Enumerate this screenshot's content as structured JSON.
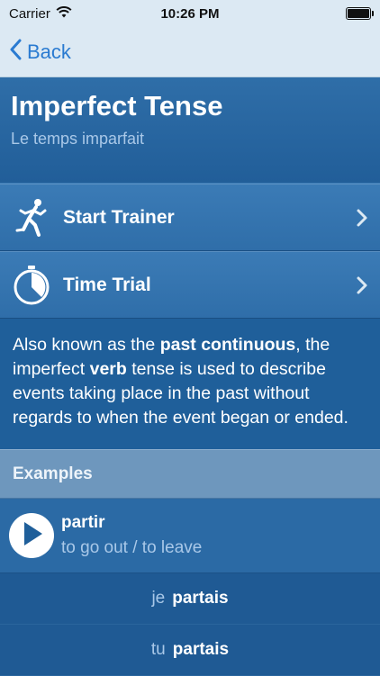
{
  "status": {
    "carrier": "Carrier",
    "time": "10:26 PM"
  },
  "nav": {
    "back_label": "Back"
  },
  "header": {
    "title": "Imperfect Tense",
    "subtitle": "Le temps imparfait"
  },
  "menu": [
    {
      "label": "Start Trainer",
      "icon": "runner-icon"
    },
    {
      "label": "Time Trial",
      "icon": "stopwatch-icon"
    }
  ],
  "description": {
    "p1": "Also known as the ",
    "b1": "past continuous",
    "p2": ", the imperfect ",
    "b2": "verb",
    "p3": " tense is used to describe events taking place in the past without regards to when the event began or ended."
  },
  "examples": {
    "header": "Examples",
    "verb": "partir",
    "meaning": "to go out / to leave",
    "conjugations": [
      {
        "pronoun": "je",
        "form": "partais"
      },
      {
        "pronoun": "tu",
        "form": "partais"
      }
    ]
  },
  "colors": {
    "accent": "#2a7bd1",
    "background": "#1f5f9a",
    "subtitle": "#a9c8e8"
  }
}
